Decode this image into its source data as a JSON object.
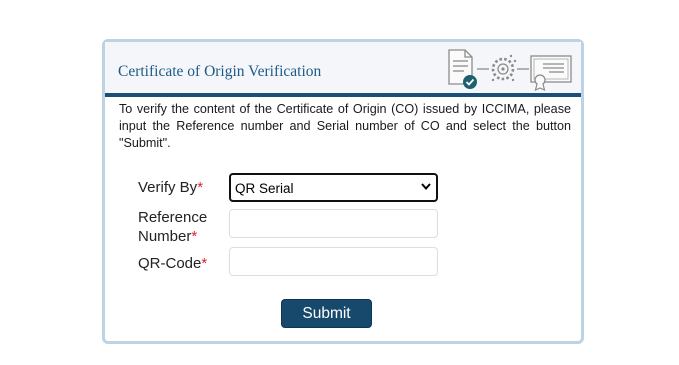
{
  "form": {
    "title": "Certificate of Origin Verification",
    "description": "To verify the content of the Certificate of Origin (CO) issued by ICCIMA, please input the Reference number and Serial number of CO and select the button \"Submit\".",
    "verify_by_label": "Verify By",
    "verify_by_value": "QR Serial",
    "reference_label_line1": "Reference",
    "reference_label_line2": "Number",
    "reference_value": "",
    "qrcode_label": "QR-Code",
    "qrcode_value": "",
    "required_mark": "*",
    "submit_label": "Submit"
  },
  "colors": {
    "accent": "#1b4f76",
    "title": "#1e5a88",
    "required": "#d9232e",
    "button": "#16496c",
    "card_border": "#bcd3e6",
    "check_badge": "#1f5f6f"
  },
  "icons": [
    "document-check-icon",
    "gear-process-icon",
    "certificate-icon"
  ]
}
